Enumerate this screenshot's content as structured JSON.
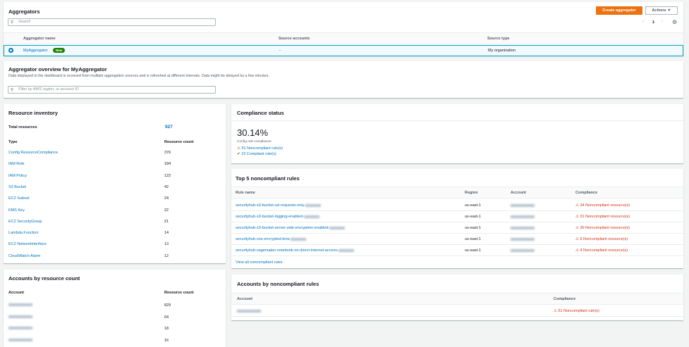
{
  "aggregators": {
    "title": "Aggregators",
    "search_placeholder": "Search",
    "create_label": "Create aggregator",
    "actions_label": "Actions",
    "page": "1",
    "columns": [
      "Aggregator name",
      "Source accounts",
      "Source type"
    ],
    "rows": [
      {
        "name": "MyAggregator",
        "badge": "New",
        "source_accounts": "-",
        "source_type": "My organization"
      }
    ]
  },
  "overview": {
    "title": "Aggregator overview for MyAggregator",
    "description": "Data displayed in the dashboard is received from multiple aggregation sources and is refreshed at different intervals. Data might be delayed by a few minutes.",
    "filter_placeholder": "Filter by AWS region, or account ID"
  },
  "inventory": {
    "title": "Resource inventory",
    "total_label": "Total resources",
    "total": "927",
    "col_type": "Type",
    "col_count": "Resource count",
    "rows": [
      {
        "type": "Config ResourceCompliance",
        "count": "376"
      },
      {
        "type": "IAM Role",
        "count": "184"
      },
      {
        "type": "IAM Policy",
        "count": "122"
      },
      {
        "type": "S3 Bucket",
        "count": "42"
      },
      {
        "type": "EC2 Subnet",
        "count": "24"
      },
      {
        "type": "KMS Key",
        "count": "22"
      },
      {
        "type": "EC2 SecurityGroup",
        "count": "21"
      },
      {
        "type": "Lambda Function",
        "count": "14"
      },
      {
        "type": "EC2 NetworkInterface",
        "count": "13"
      },
      {
        "type": "CloudWatch Alarm",
        "count": "12"
      }
    ]
  },
  "compliance": {
    "title": "Compliance status",
    "percent": "30.14%",
    "subtitle": "Config rule compliance",
    "noncompliant": "51 Noncompliant rule(s)",
    "compliant": "22 Compliant rule(s)"
  },
  "top5": {
    "title": "Top 5 noncompliant rules",
    "columns": [
      "Rule name",
      "Region",
      "Account",
      "Compliance"
    ],
    "rows": [
      {
        "rule": "securityhub-s3-bucket-ssl-requests-only-",
        "region": "us-east-1",
        "compliance": "34 Noncompliant resource(s)"
      },
      {
        "rule": "securityhub-s3-bucket-logging-enabled-",
        "region": "us-east-1",
        "compliance": "31 Noncompliant resource(s)"
      },
      {
        "rule": "securityhub-s3-bucket-server-side-encryption-enabled-",
        "region": "us-east-1",
        "compliance": "30 Noncompliant resource(s)"
      },
      {
        "rule": "securityhub-sns-encrypted-kms-",
        "region": "us-east-1",
        "compliance": "6 Noncompliant resource(s)"
      },
      {
        "rule": "securityhub-sagemaker-notebook-no-direct-internet-access-",
        "region": "us-east-1",
        "compliance": "4 Noncompliant resource(s)"
      }
    ],
    "view_all": "View all noncompliant rules"
  },
  "accounts_resource": {
    "title": "Accounts by resource count",
    "col_account": "Account",
    "col_count": "Resource count",
    "rows": [
      {
        "count": "829"
      },
      {
        "count": "64"
      },
      {
        "count": "18"
      },
      {
        "count": "16"
      }
    ]
  },
  "accounts_noncompliant": {
    "title": "Accounts by noncompliant rules",
    "col_account": "Account",
    "col_compliance": "Compliance",
    "rows": [
      {
        "compliance": "51 Noncompliant rule(s)"
      }
    ]
  },
  "colors": {
    "accent": "#ec7211",
    "link": "#0073bb",
    "error": "#d13212",
    "success": "#1d8102"
  }
}
